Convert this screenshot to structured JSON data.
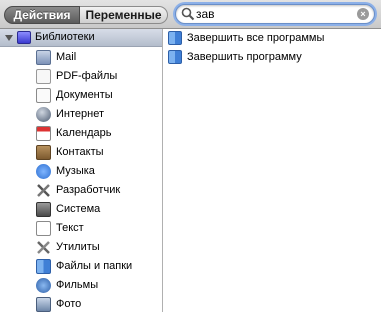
{
  "toolbar": {
    "actions_label": "Действия",
    "variables_label": "Переменные"
  },
  "search": {
    "value": "зав",
    "icon": "magnifier-icon",
    "clear_icon": "clear-icon"
  },
  "library": {
    "header": "Библиотеки",
    "expanded": true,
    "items": [
      {
        "label": "Mail",
        "icon": "mail-icon"
      },
      {
        "label": "PDF-файлы",
        "icon": "pdf-icon"
      },
      {
        "label": "Документы",
        "icon": "document-icon"
      },
      {
        "label": "Интернет",
        "icon": "internet-icon"
      },
      {
        "label": "Календарь",
        "icon": "calendar-icon"
      },
      {
        "label": "Контакты",
        "icon": "contacts-icon"
      },
      {
        "label": "Музыка",
        "icon": "music-icon"
      },
      {
        "label": "Разработчик",
        "icon": "developer-icon"
      },
      {
        "label": "Система",
        "icon": "system-icon"
      },
      {
        "label": "Текст",
        "icon": "text-icon"
      },
      {
        "label": "Утилиты",
        "icon": "utilities-icon"
      },
      {
        "label": "Файлы и папки",
        "icon": "finder-icon"
      },
      {
        "label": "Фильмы",
        "icon": "movies-icon"
      },
      {
        "label": "Фото",
        "icon": "photo-icon"
      }
    ]
  },
  "results": [
    {
      "label": "Завершить все программы",
      "icon": "finder-icon"
    },
    {
      "label": "Завершить программу",
      "icon": "finder-icon"
    }
  ],
  "colors": {
    "search_focus": "#8cb0e8",
    "header_blue": "#b4bdcc"
  }
}
